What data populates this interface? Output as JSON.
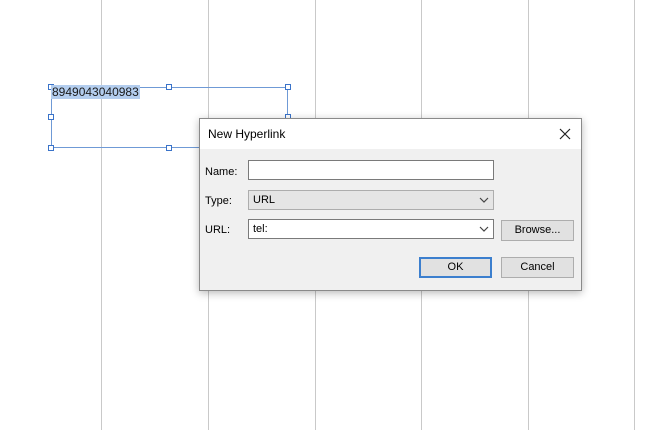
{
  "page": {
    "frame_text": "8949043040983"
  },
  "dialog": {
    "title": "New Hyperlink",
    "name_label": "Name:",
    "name_value": "",
    "type_label": "Type:",
    "type_value": "URL",
    "url_label": "URL:",
    "url_value": "tel:",
    "browse_label": "Browse...",
    "ok_label": "OK",
    "cancel_label": "Cancel"
  },
  "colors": {
    "selection_highlight": "#b3cdee",
    "frame_border": "#6f9ad6",
    "default_button_border": "#3c7fce"
  },
  "icons": {
    "close": "close-icon",
    "dropdown": "chevron-down-icon"
  }
}
